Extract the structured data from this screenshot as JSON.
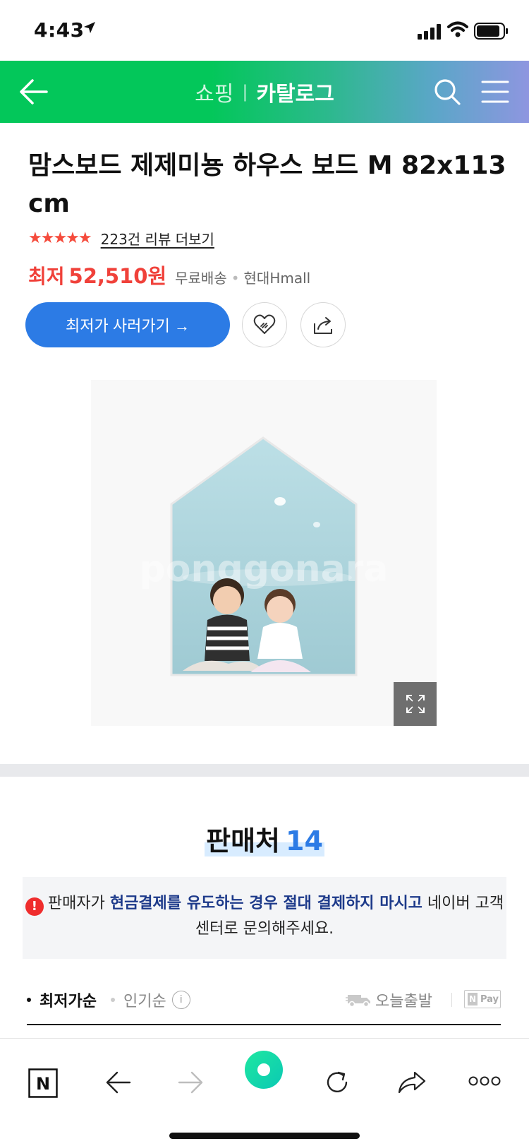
{
  "status_bar": {
    "time": "4:43"
  },
  "header": {
    "title_shopping": "쇼핑",
    "title_catalog": "카탈로그"
  },
  "product": {
    "title": "맘스보드 제제미뇽 하우스 보드 M 82x113cm",
    "rating_stars": "★★★★★",
    "review_link": "223건 리뷰 더보기",
    "price_label": "최저",
    "price": "52,510원",
    "shipping": "무료배송",
    "mall": "현대Hmall",
    "buy_button": "최저가 사러가기 →",
    "image_watermark": "ponggonara"
  },
  "sellers": {
    "title": "판매처",
    "count": "14",
    "notice_prefix": "판매자가 ",
    "notice_strong": "현금결제를 유도하는 경우 절대 결제하지 마시고",
    "notice_suffix": " 네이버 고객센터로 문의해주세요."
  },
  "sort": {
    "active": "최저가순",
    "other": "인기순",
    "info": "i",
    "today_ship": "오늘출발",
    "npay_n": "N",
    "npay_label": "Pay"
  },
  "toolbar": {
    "naver_letter": "N"
  },
  "colors": {
    "brand_green": "#03c75a",
    "price_red": "#f0413a",
    "button_blue": "#2c7be5"
  }
}
